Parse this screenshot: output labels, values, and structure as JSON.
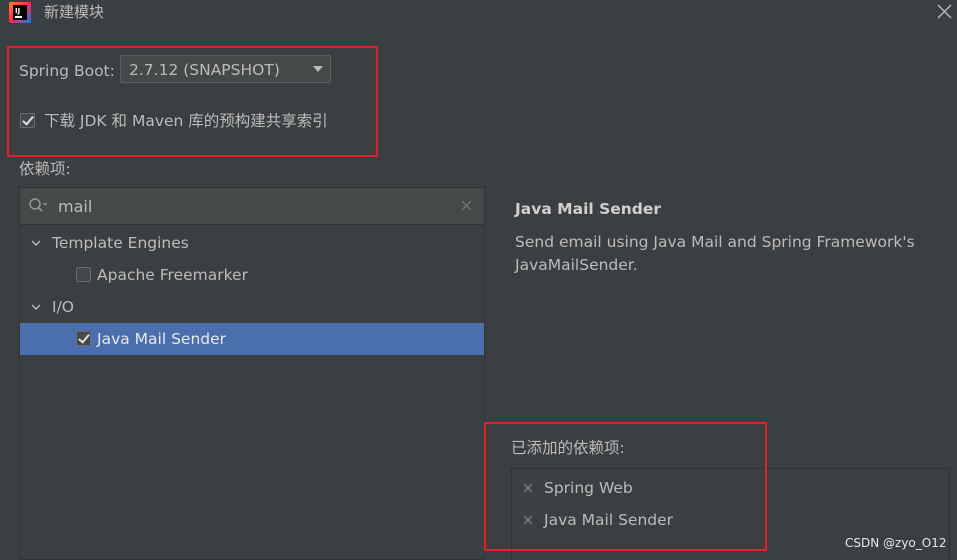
{
  "window": {
    "title": "新建模块",
    "app_icon": "intellij-idea-icon",
    "close_icon": "close-icon"
  },
  "spring_boot": {
    "label": "Spring Boot:",
    "selected_version": "2.7.12 (SNAPSHOT)"
  },
  "download_index": {
    "checked": true,
    "label": "下载 JDK 和 Maven 库的预构建共享索引"
  },
  "dependencies": {
    "label": "依赖项:",
    "search": {
      "value": "mail",
      "icon": "search-icon",
      "clear_icon": "clear-icon"
    },
    "tree": [
      {
        "type": "group",
        "label": "Template Engines",
        "expanded": true
      },
      {
        "type": "item",
        "label": "Apache Freemarker",
        "checked": false,
        "selected": false
      },
      {
        "type": "group",
        "label": "I/O",
        "expanded": true
      },
      {
        "type": "item",
        "label": "Java Mail Sender",
        "checked": true,
        "selected": true
      }
    ]
  },
  "detail": {
    "title": "Java Mail Sender",
    "description": "Send email using Java Mail and Spring Framework's JavaMailSender."
  },
  "added": {
    "label": "已添加的依赖项:",
    "items": [
      "Spring Web",
      "Java Mail Sender"
    ]
  },
  "watermark": "CSDN @zyo_O12",
  "colors": {
    "background": "#3c3f41",
    "selection": "#4b6eaf",
    "highlight_red": "#e0202a",
    "text": "#bbbbbb"
  }
}
